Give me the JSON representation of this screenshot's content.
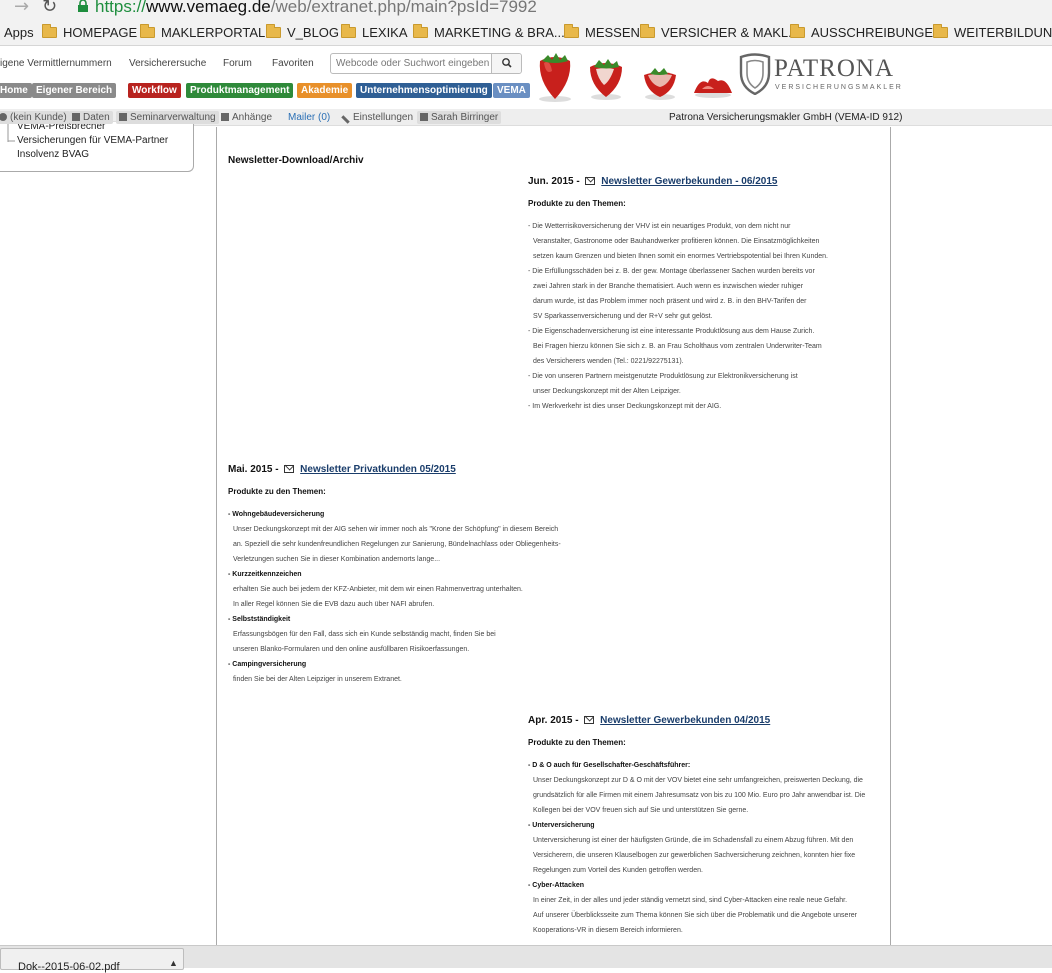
{
  "browser": {
    "url_scheme": "https://",
    "url_host": "www.vemaeg.de",
    "url_path": "/web/extranet.php/main?psId=7992",
    "bookmarks": [
      "Apps",
      "HOMEPAGE",
      "MAKLERPORTALE",
      "V_BLOG",
      "LEXIKA",
      "MARKETING & BRA...",
      "MESSEN",
      "VERSICHER & MAKL...",
      "AUSSCHREIBUNGEN",
      "WEITERBILDUNG"
    ]
  },
  "header": {
    "links": [
      "igene Vermittlernummern",
      "Versicherersuche",
      "Forum",
      "Favoriten"
    ],
    "search_placeholder": "Webcode oder Suchwort eingeben",
    "logo_word": "PATRONA",
    "logo_sub": "VERSICHERUNGSMAKLER",
    "nav_tabs": [
      {
        "label": "Home",
        "color": "#8a8a8a"
      },
      {
        "label": "Eigener Bereich",
        "color": "#8a8a8a"
      },
      {
        "label": "Workflow",
        "color": "#b8231f"
      },
      {
        "label": "Produktmanagement",
        "color": "#2f8a3a"
      },
      {
        "label": "Akademie",
        "color": "#e8902a"
      },
      {
        "label": "Unternehmensoptimierung",
        "color": "#2f5f95"
      },
      {
        "label": "VEMA",
        "color": "#6a8fc2"
      }
    ]
  },
  "toolbar": {
    "items": [
      "(kein Kunde)",
      "Daten",
      "Seminarverwaltung",
      "Anhänge",
      "Mailer (0)",
      "Einstellungen",
      "Sarah Birringer"
    ],
    "company": "Patrona Versicherungsmakler GmbH (VEMA-ID 912)"
  },
  "left_panel": {
    "items": [
      "VEMA-Preisbrecher",
      "Versicherungen für VEMA-Partner",
      "Insolvenz BVAG"
    ]
  },
  "content": {
    "section_title": "Newsletter-Download/Archiv",
    "produkte_label": "Produkte zu den Themen:",
    "newsletters": [
      {
        "date": "Jun. 2015 -",
        "title": "Newsletter Gewerbekunden - 06/2015",
        "lines": [
          "- Die |Wetterrisikoversicherung der VHV| ist ein neuartiges Produkt, von dem nicht nur",
          "Veranstalter, Gastronome oder Bauhandwerker profitieren können. Die Einsatzmöglichkeiten",
          "setzen kaum Grenzen und bieten Ihnen somit ein enormes Vertriebspotential bei Ihren Kunden.",
          "- Die Erfüllungsschäden bei z. B. der gew. Montage überlassener Sachen wurden bereits vor",
          "zwei Jahren stark in der Branche thematisiert. Auch wenn es inzwischen wieder ruhiger",
          "darum wurde, ist das Problem immer noch präsent und wird z. B. in den BHV-Tarifen der",
          "SV Sparkassenversicherung und der R+V sehr gut gelöst.",
          "- Die Eigenschadenversicherung ist eine interessante Produktlösung aus dem Hause Zurich.",
          "Bei Fragen hierzu können Sie sich z. B. an Frau Scholthaus vom zentralen Underwriter-Team",
          "des Versicherers wenden (Tel.: 0221/92275131).",
          "- Die von unseren Partnern meistgenutzte Produktlösung zur Elektronikversicherung ist",
          "unser Deckungskonzept mit der Alten Leipziger.",
          "- Im Werkverkehr ist dies unser Deckungskonzept mit der AIG."
        ]
      },
      {
        "date": "Mai. 2015 -",
        "title": "Newsletter Privatkunden 05/2015",
        "lines": [
          "- Wohngebäudeversicherung",
          "Unser Deckungskonzept mit der AIG sehen wir immer noch als \"Krone der Schöpfung\" in diesem Bereich",
          "an. Speziell die sehr kundenfreundlichen Regelungen zur Sanierung, Bündelnachlass oder Obliegenheits-",
          "Verletzungen suchen Sie in dieser Kombination andernorts lange...",
          "- Kurzzeitkennzeichen",
          "erhalten Sie auch bei jedem der KFZ-Anbieter, mit dem wir einen Rahmenvertrag unterhalten.",
          "In aller Regel können Sie die EVB dazu auch über NAFI abrufen.",
          "- Selbstständigkeit",
          "Erfassungsbögen für den Fall, dass sich ein Kunde selbständig macht, finden Sie bei",
          "unseren Blanko-Formularen und den online ausfüllbaren Risikoerfassungen.",
          "- Campingversicherung",
          "finden Sie bei der Alten Leipziger in unserem Extranet."
        ]
      },
      {
        "date": "Apr. 2015 -",
        "title": "Newsletter Gewerbekunden 04/2015",
        "lines": [
          "- D & O auch für Gesellschafter-Geschäftsführer:",
          "Unser Deckungskonzept zur D & O mit der VOV bietet eine sehr umfangreichen, preiswerten Deckung, die",
          "grundsätzlich für alle Firmen mit einem Jahresumsatz von bis zu 100 Mio. Euro pro Jahr anwendbar ist. Die",
          "Kollegen bei der VOV freuen sich auf Sie und unterstützen Sie gerne.",
          "- Unterversicherung",
          "Unterversicherung ist einer der häufigsten Gründe, die im Schadensfall zu einem Abzug führen. Mit den",
          "Versicherern, die unseren Klauselbogen zur gewerblichen Sachversicherung zeichnen, konnten hier fixe",
          "Regelungen zum Vorteil des Kunden getroffen werden.",
          "- Cyber-Attacken",
          "In einer Zeit, in der alles und jeder ständig vernetzt sind, sind Cyber-Attacken eine reale neue Gefahr.",
          "Auf unserer Überblicksseite zum Thema können Sie sich über die Problematik und die Angebote unserer",
          "Kooperations-VR in diesem Bereich informieren."
        ]
      }
    ]
  },
  "download_bar": {
    "filename": "Dok--2015-06-02.pdf"
  }
}
